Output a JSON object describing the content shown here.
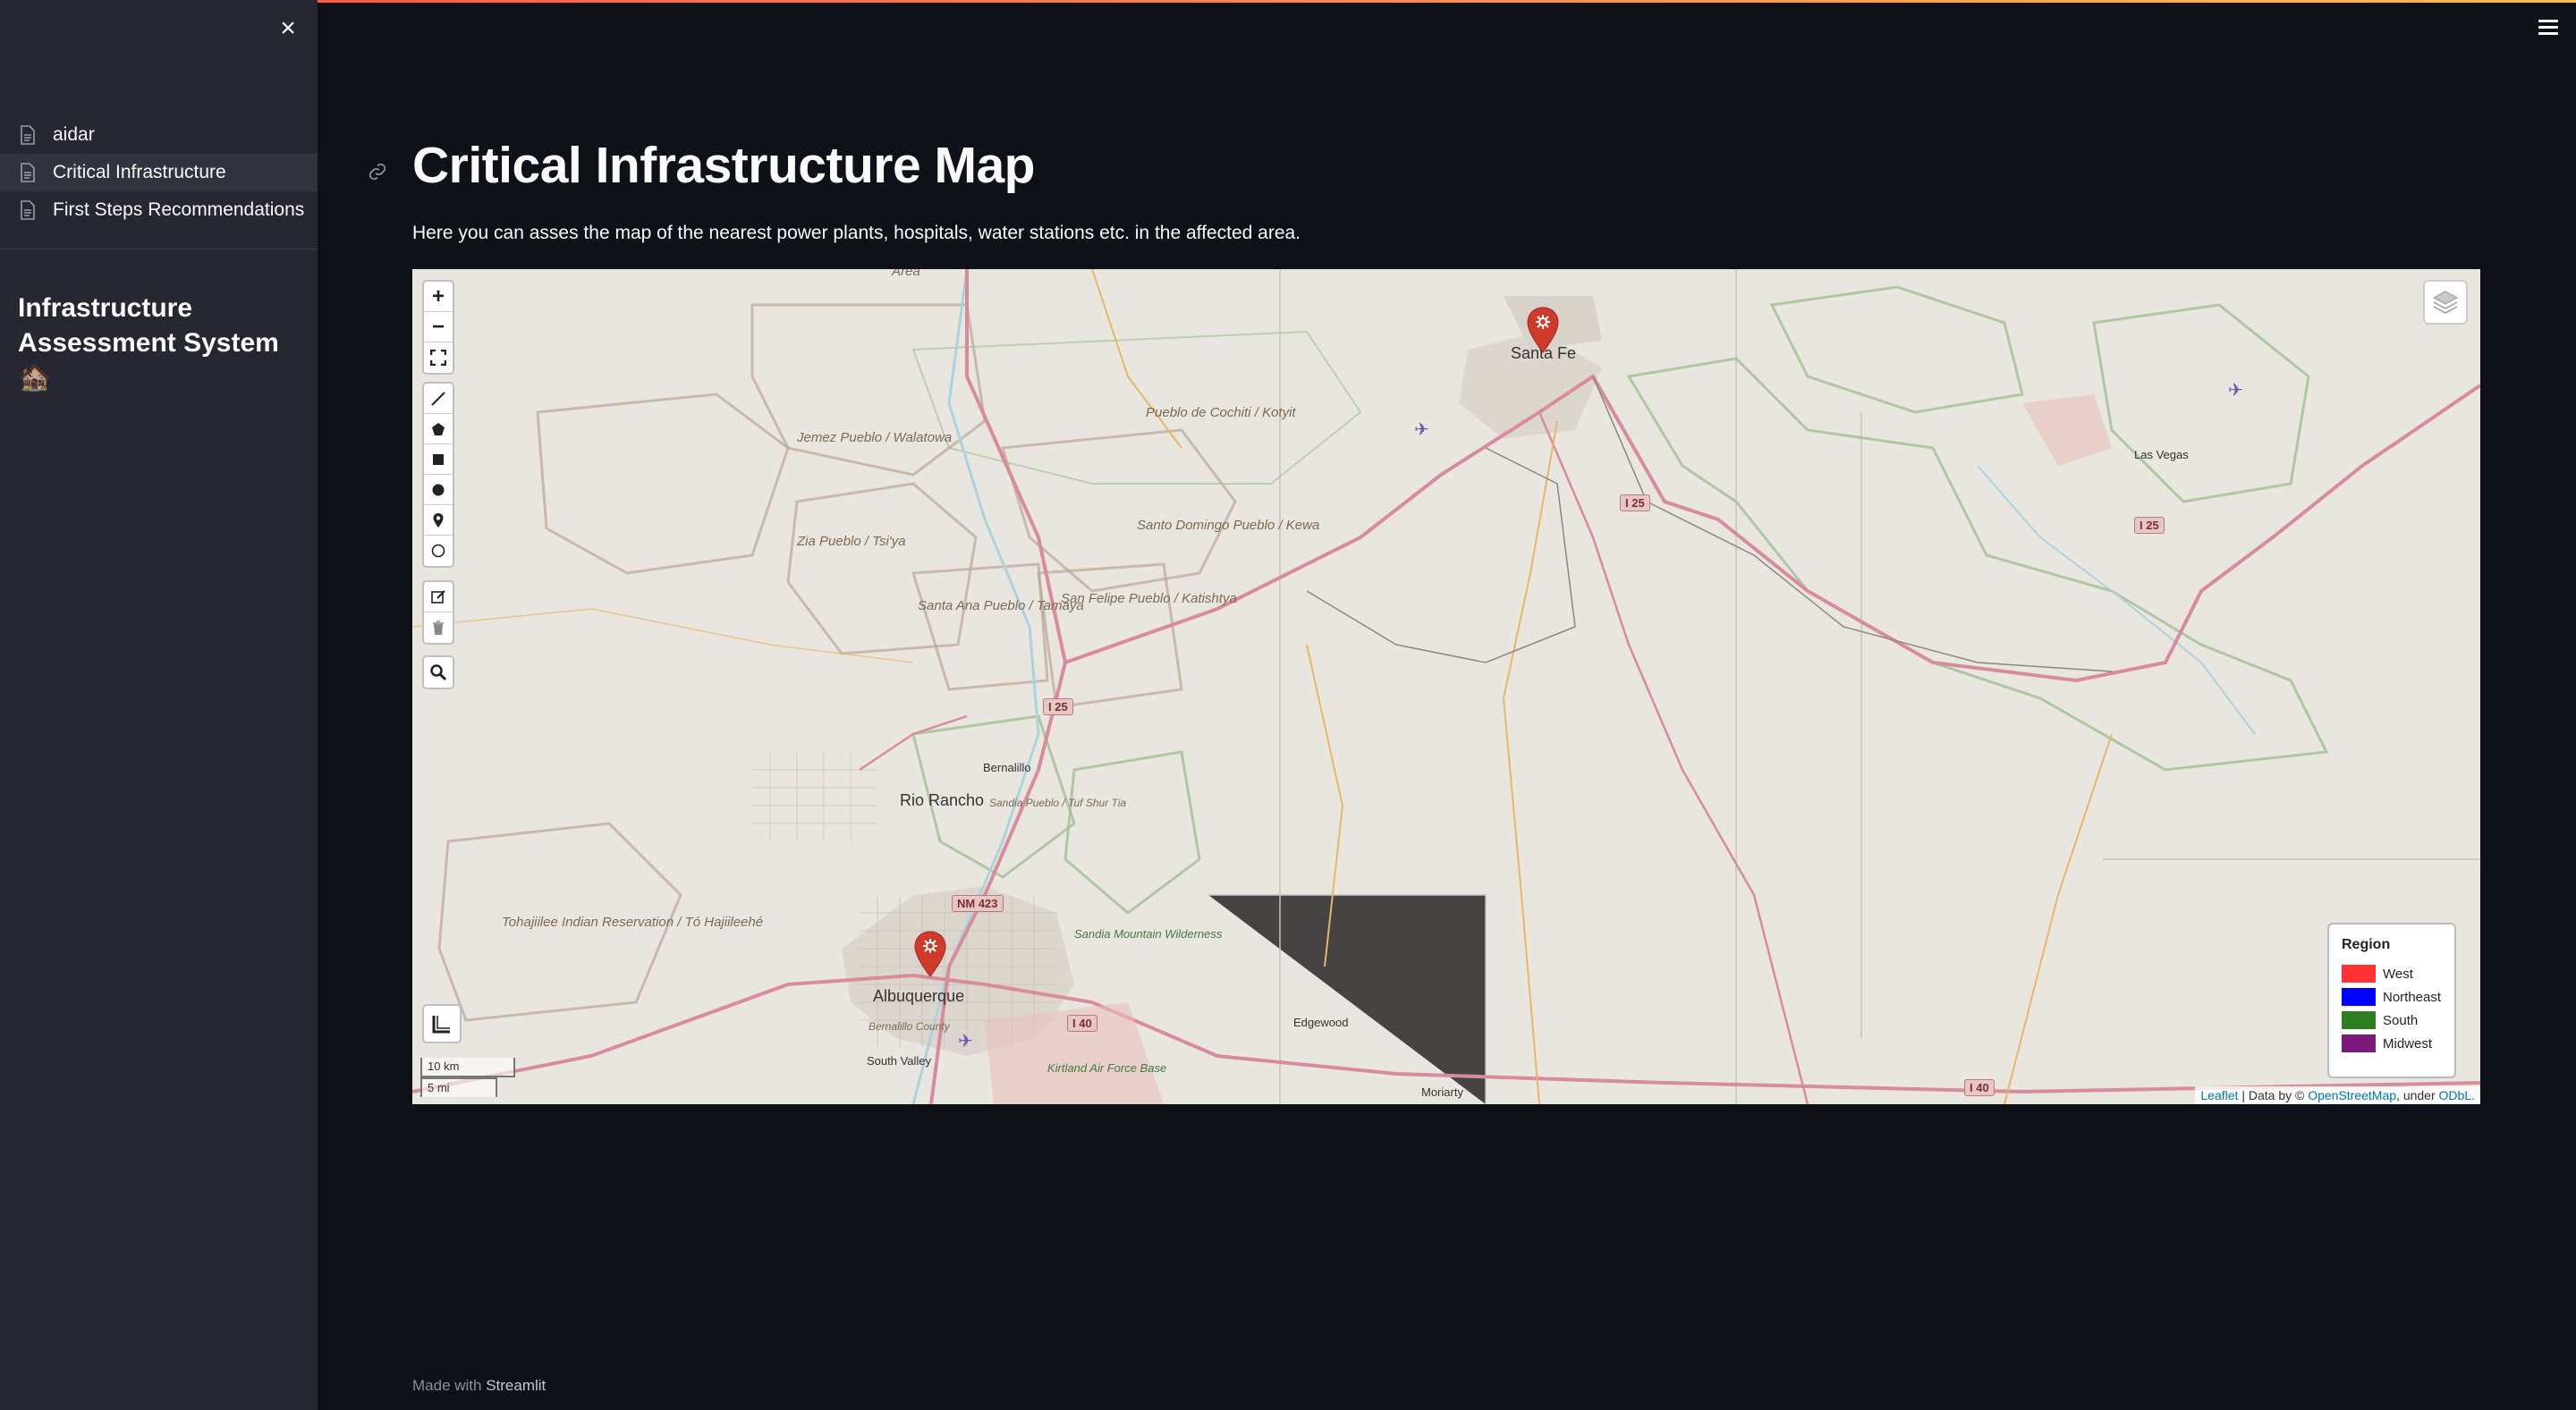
{
  "sidebar": {
    "close_label": "×",
    "items": [
      {
        "label": "aidar"
      },
      {
        "label": "Critical Infrastructure"
      },
      {
        "label": "First Steps Recommendations"
      }
    ],
    "title": "Infrastructure Assessment System 🏚️"
  },
  "main": {
    "title": "Critical Infrastructure Map",
    "description": "Here you can asses the map of the nearest power plants, hospitals, water stations etc. in the affected area."
  },
  "map": {
    "toolbar": {
      "zoom_in": "+",
      "zoom_out": "−"
    },
    "labels": {
      "cities": [
        "Santa Fe",
        "Albuquerque",
        "Rio Rancho",
        "Las Vegas"
      ],
      "towns": [
        "Bernalillo",
        "Edgewood",
        "Moriarty",
        "South Valley"
      ],
      "areas": [
        "Jemez Pueblo / Walatowa",
        "Pueblo de Cochiti / Kotyit",
        "Zia Pueblo / Tsi'ya",
        "Santo Domingo Pueblo / Kewa",
        "Santa Ana Pueblo / Tamaya",
        "San Felipe Pueblo / Katishtya",
        "Sandia Pueblo / Tuf Shur Tia",
        "Tohajiilee Indian Reservation / Tó Hajiileehé",
        "Bernalillo County",
        "Area"
      ],
      "parks": [
        "Sandia Mountain Wilderness",
        "Kirtland Air Force Base"
      ]
    },
    "shields": [
      "I 25",
      "I 25",
      "I 25",
      "NM 423",
      "I 40",
      "I 40"
    ],
    "markers": [
      "santa-fe",
      "albuquerque"
    ],
    "legend": {
      "title": "Region",
      "items": [
        {
          "label": "West",
          "color": "#ff3333"
        },
        {
          "label": "Northeast",
          "color": "#0000ff"
        },
        {
          "label": "South",
          "color": "#2e7d1e"
        },
        {
          "label": "Midwest",
          "color": "#7b1a7b"
        }
      ]
    },
    "scale": {
      "km": "10 km",
      "mi": "5 mi"
    },
    "attribution": {
      "leaflet": "Leaflet",
      "data_by": " | Data by © ",
      "osm": "OpenStreetMap",
      "under": ", under ",
      "odbl": "ODbL."
    }
  },
  "footer": {
    "made_with": "Made with ",
    "brand": "Streamlit"
  }
}
